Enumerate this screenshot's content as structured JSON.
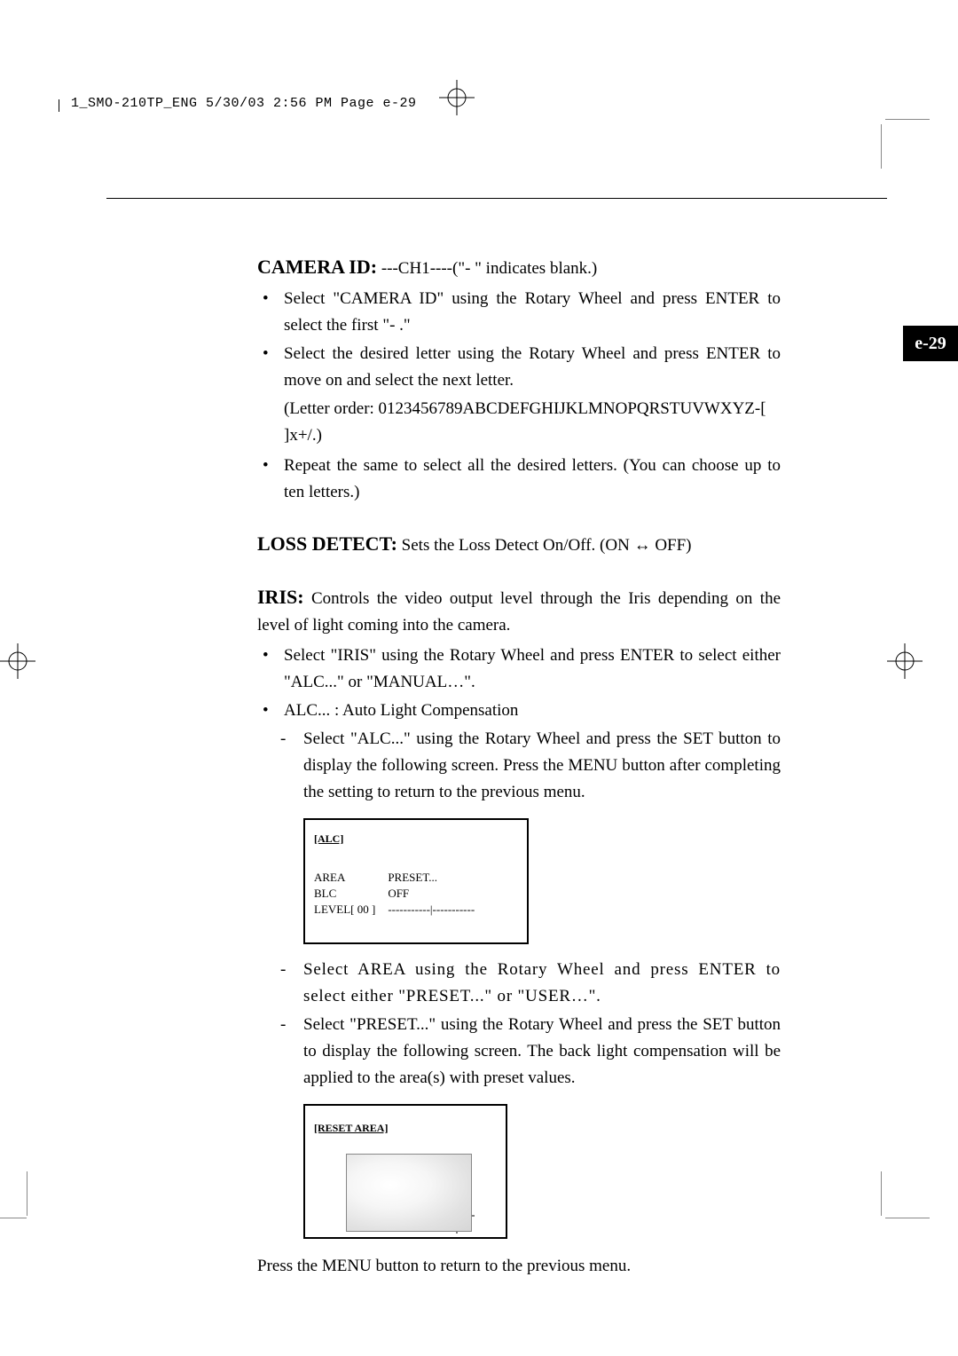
{
  "header": "1_SMO-210TP_ENG  5/30/03  2:56 PM  Page e-29",
  "pageTab": "e-29",
  "camera": {
    "title": "CAMERA ID:",
    "desc": " ---CH1----(\"- \" indicates blank.)",
    "b1": "Select \"CAMERA ID\" using the Rotary Wheel and press  ENTER to select the first \"- .\"",
    "b2": "Select the desired letter using the Rotary Wheel and press  ENTER to  move on and select the next letter.",
    "note": "(Letter order: 0123456789ABCDEFGHIJKLMNOPQRSTUVWXYZ-[ ]x+/.)",
    "b3": "Repeat the same to select all the desired letters. (You can choose up to ten letters.)"
  },
  "loss": {
    "title": "LOSS DETECT:",
    "desc": " Sets the Loss Detect On/Off. (ON ↔ OFF)"
  },
  "iris": {
    "title": "IRIS:",
    "desc": " Controls the video output level through the Iris depending on the level of light coming into the camera.",
    "b1": "Select \"IRIS\" using the Rotary Wheel and press  ENTER to select either \"ALC...\" or \"MANUAL…\".",
    "b2": "ALC... : Auto Light Compensation",
    "d1": "Select \"ALC...\" using the Rotary Wheel and press the SET button to display the following screen. Press the MENU button after completing the setting to return to the previous menu.",
    "d2": "Select AREA using the Rotary Wheel and press ENTER to select either \"PRESET...\" or \"USER…\".",
    "d3": "Select \"PRESET...\" using the Rotary Wheel and press the SET button to display the following screen. The back light compensation will be applied to the area(s) with preset values."
  },
  "alcBox": {
    "header": "[ALC]",
    "r1a": "AREA",
    "r1b": "PRESET...",
    "r2a": "BLC",
    "r2b": "OFF",
    "r3a": "LEVEL[ 00 ]",
    "r3b": "-----------|-----------"
  },
  "presetBox": {
    "header": "[RESET AREA]"
  },
  "footer": "Press the MENU button to return to the previous menu."
}
